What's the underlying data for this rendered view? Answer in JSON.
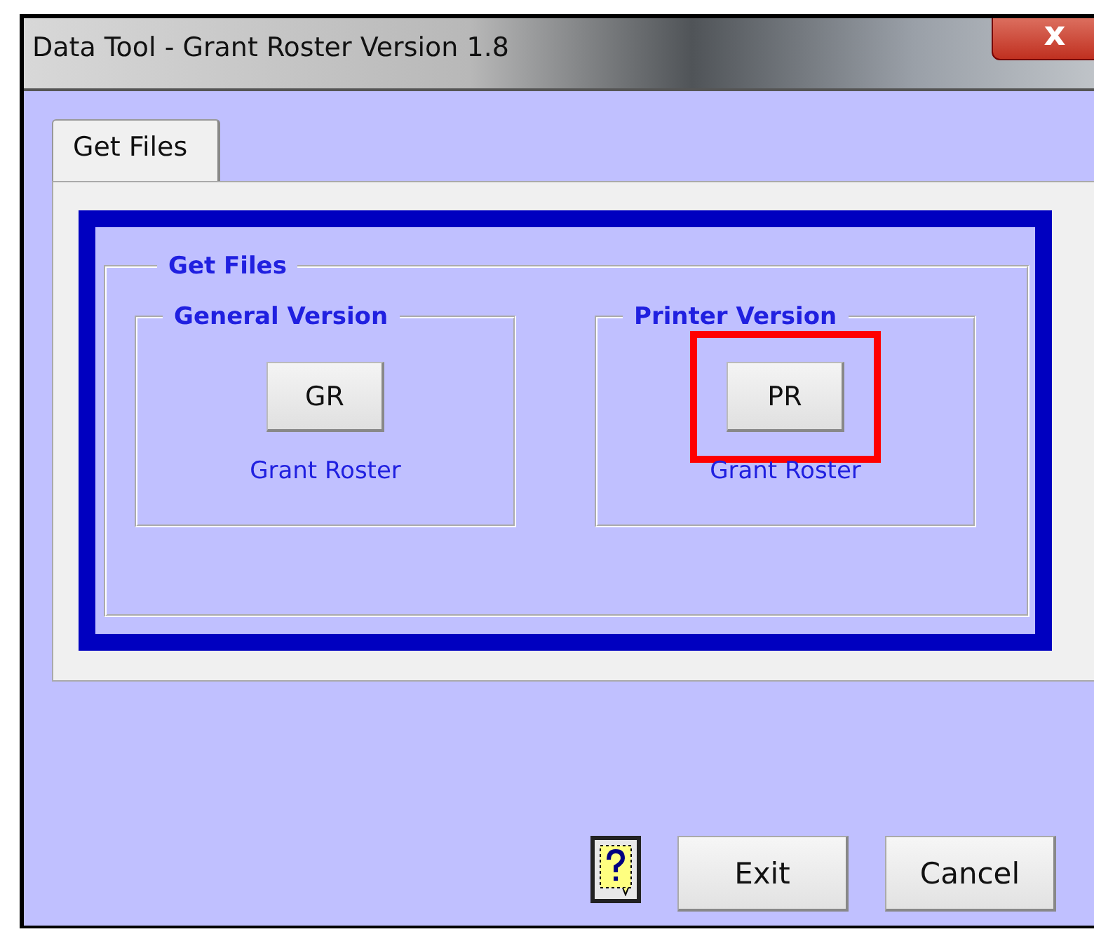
{
  "window": {
    "title": "Data Tool - Grant Roster Version 1.8",
    "close": "x"
  },
  "tabs": [
    {
      "label": "Get Files",
      "selected": true
    }
  ],
  "panel": {
    "legend": "Get Files",
    "groups": [
      {
        "legend": "General Version",
        "button": "GR",
        "caption": "Grant Roster",
        "highlighted": false
      },
      {
        "legend": "Printer Version",
        "button": "PR",
        "caption": "Grant Roster",
        "highlighted": true
      }
    ]
  },
  "buttons": [
    {
      "kind": "help"
    },
    {
      "kind": "text",
      "label": "Exit"
    },
    {
      "kind": "text",
      "label": "Cancel"
    }
  ]
}
